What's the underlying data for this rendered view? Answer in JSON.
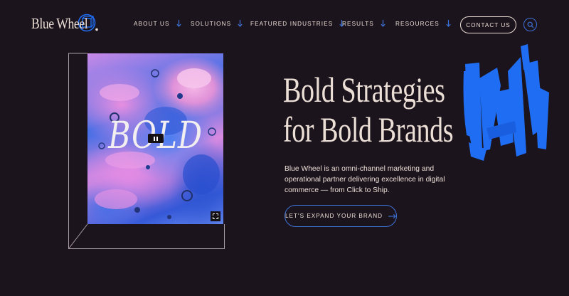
{
  "brand": {
    "name": "Blue Wheel",
    "accent_color": "#1f6df2",
    "background_color": "#1c141d",
    "text_color": "#ecdfd6"
  },
  "nav": {
    "items": [
      {
        "label": "ABOUT US",
        "icon": "arrow-down-icon"
      },
      {
        "label": "SOLUTIONS",
        "icon": "arrow-down-icon"
      },
      {
        "label": "FEATURED INDUSTRIES",
        "icon": "arrow-down-icon"
      },
      {
        "label": "RESULTS",
        "icon": "arrow-down-icon"
      },
      {
        "label": "RESOURCES",
        "icon": "arrow-down-icon"
      }
    ],
    "contact_label": "CONTACT US",
    "search_icon": "search-icon"
  },
  "hero": {
    "art_word": "BOLD",
    "headline_line1": "Bold Strategies",
    "headline_line2": "for Bold Brands",
    "description": "Blue Wheel is an omni-channel marketing and operational partner delivering excellence in digital commerce — from Click to Ship.",
    "cta_label": "LET'S EXPAND YOUR BRAND",
    "cta_icon": "arrow-right-icon",
    "video_controls": [
      "pause-icon",
      "expand-icon"
    ]
  }
}
